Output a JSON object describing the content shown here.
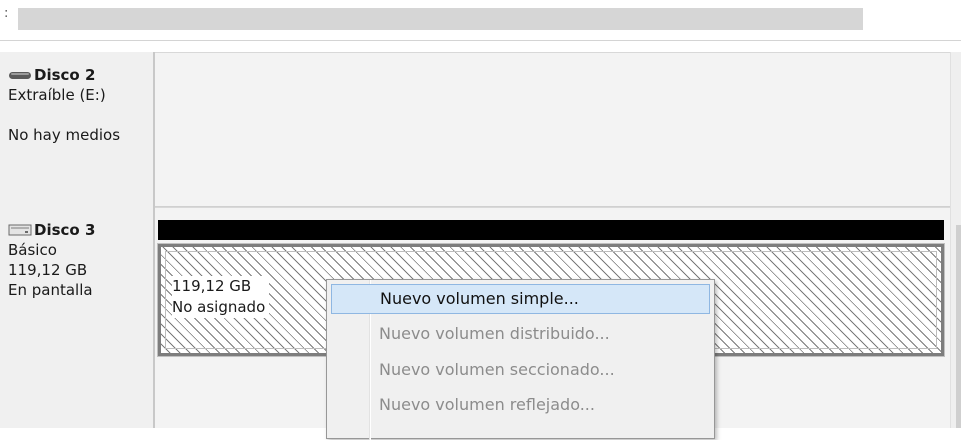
{
  "top": {
    "fragment": ":"
  },
  "disks": [
    {
      "name": "Disco 2",
      "type": "Extraíble (E:)",
      "status": "No hay medios",
      "icon": "removable-drive-icon"
    },
    {
      "name": "Disco 3",
      "type": "Básico",
      "size": "119,12 GB",
      "status": "En pantalla",
      "icon": "basic-disk-icon",
      "volume": {
        "size": "119,12 GB",
        "label": "No asignado"
      }
    }
  ],
  "context_menu": {
    "items": [
      {
        "label": "Nuevo volumen simple...",
        "enabled": true
      },
      {
        "label": "Nuevo volumen distribuido...",
        "enabled": false
      },
      {
        "label": "Nuevo volumen seccionado...",
        "enabled": false
      },
      {
        "label": "Nuevo volumen reflejado...",
        "enabled": false
      }
    ]
  },
  "colors": {
    "highlight": "#d5e7f8",
    "highlight_border": "#8fb7e2",
    "disabled_text": "#8c8c8c",
    "volume_bar": "#000000"
  }
}
